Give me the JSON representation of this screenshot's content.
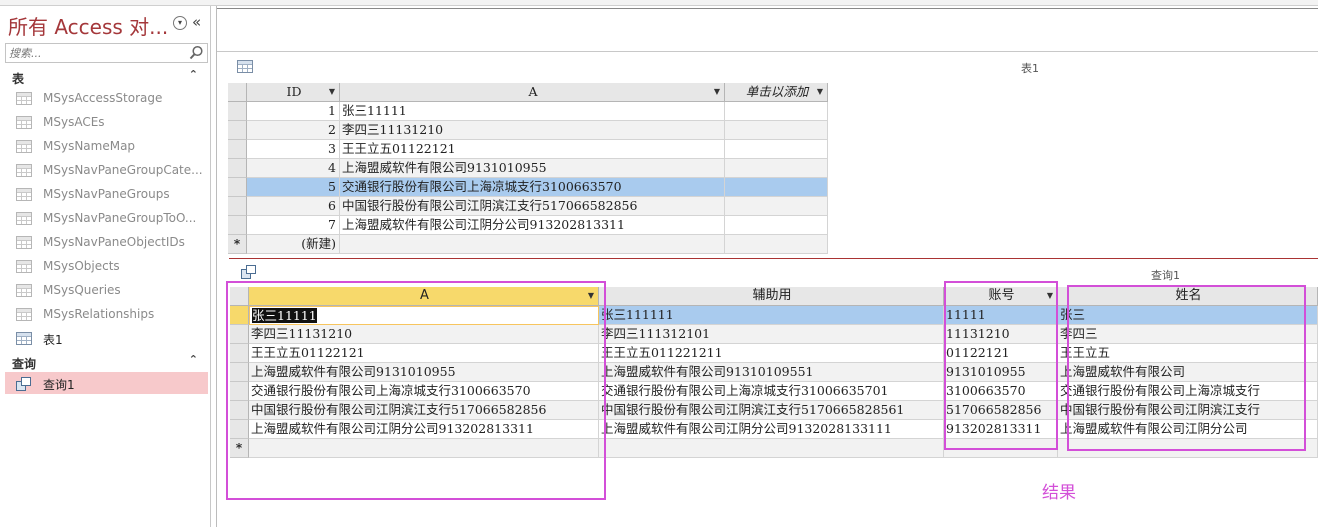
{
  "nav": {
    "title": "所有 Access 对...",
    "search_placeholder": "搜索...",
    "groups": [
      {
        "label": "表",
        "items": [
          {
            "label": "MSysAccessStorage",
            "system": true
          },
          {
            "label": "MSysACEs",
            "system": true
          },
          {
            "label": "MSysNameMap",
            "system": true
          },
          {
            "label": "MSysNavPaneGroupCate...",
            "system": true
          },
          {
            "label": "MSysNavPaneGroups",
            "system": true
          },
          {
            "label": "MSysNavPaneGroupToO...",
            "system": true
          },
          {
            "label": "MSysNavPaneObjectIDs",
            "system": true
          },
          {
            "label": "MSysObjects",
            "system": true
          },
          {
            "label": "MSysQueries",
            "system": true
          },
          {
            "label": "MSysRelationships",
            "system": true
          },
          {
            "label": "表1",
            "system": false
          }
        ]
      },
      {
        "label": "查询",
        "items": [
          {
            "label": "查询1",
            "selected": true
          }
        ]
      }
    ]
  },
  "table1": {
    "title": "表1",
    "columns": [
      "ID",
      "A",
      "单击以添加"
    ],
    "rows": [
      {
        "id": "1",
        "a": "张三11111"
      },
      {
        "id": "2",
        "a": "李四三11131210"
      },
      {
        "id": "3",
        "a": "王王立五01122121"
      },
      {
        "id": "4",
        "a": "上海盟威软件有限公司9131010955"
      },
      {
        "id": "5",
        "a": "交通银行股份有限公司上海凉城支行3100663570"
      },
      {
        "id": "6",
        "a": "中国银行股份有限公司江阴滨江支行517066582856"
      },
      {
        "id": "7",
        "a": "上海盟威软件有限公司江阴分公司913202813311"
      }
    ],
    "new_row_label": "(新建)",
    "new_row_marker": "*"
  },
  "query1": {
    "title": "查询1",
    "columns": [
      "A",
      "辅助用",
      "账号",
      "姓名"
    ],
    "rows": [
      [
        "张三11111",
        "张三111111",
        "11111",
        "张三"
      ],
      [
        "李四三11131210",
        "李四三111312101",
        "11131210",
        "李四三"
      ],
      [
        "王王立五01122121",
        "王王立五011221211",
        "01122121",
        "王王立五"
      ],
      [
        "上海盟威软件有限公司9131010955",
        "上海盟威软件有限公司91310109551",
        "9131010955",
        "上海盟威软件有限公司"
      ],
      [
        "交通银行股份有限公司上海凉城支行3100663570",
        "交通银行股份有限公司上海凉城支行31006635701",
        "3100663570",
        "交通银行股份有限公司上海凉城支行"
      ],
      [
        "中国银行股份有限公司江阴滨江支行517066582856",
        "中国银行股份有限公司江阴滨江支行5170665828561",
        "517066582856",
        "中国银行股份有限公司江阴滨江支行"
      ],
      [
        "上海盟威软件有限公司江阴分公司913202813311",
        "上海盟威软件有限公司江阴分公司9132028133111",
        "913202813311",
        "上海盟威软件有限公司江阴分公司"
      ]
    ],
    "new_row_marker": "*"
  },
  "annotation": {
    "result_label": "结果",
    "highlight_color": "#d34fd8"
  },
  "colors": {
    "title_red": "#a4373a",
    "selected_nav": "#f7c9cb",
    "row_highlight": "#a9cbee",
    "header_yellow": "#f7d96b"
  }
}
